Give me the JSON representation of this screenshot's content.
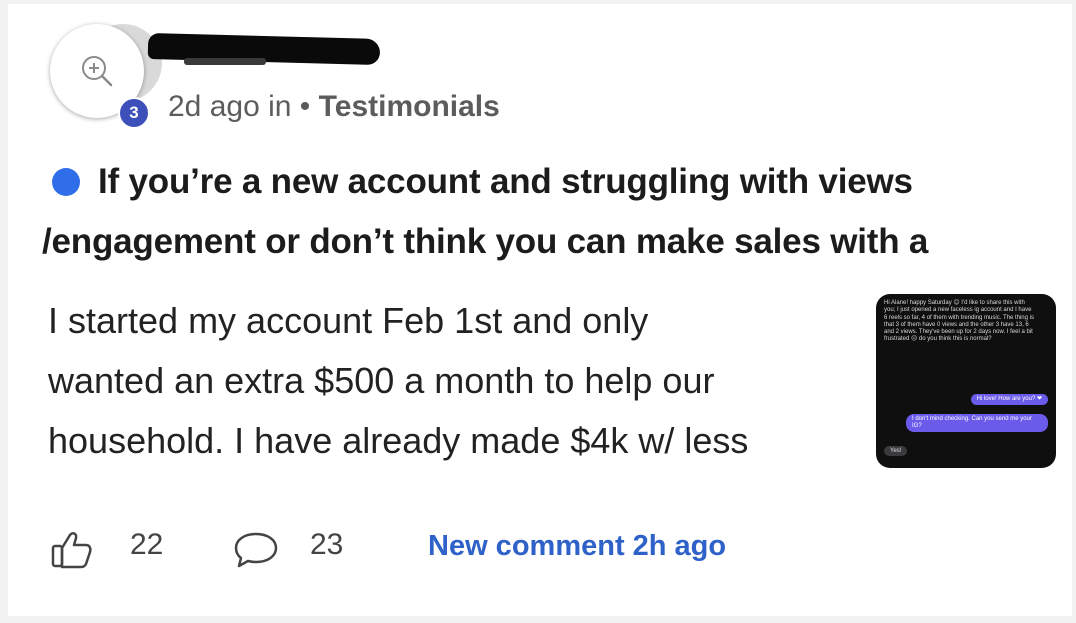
{
  "post": {
    "author_level": "3",
    "time_ago": "2d ago in",
    "separator": "•",
    "category": "Testimonials",
    "title_lines": [
      "If you’re a new account and struggling with views",
      "/engagement or don’t think you can make sales with a"
    ],
    "body_lines": [
      "I started my account Feb 1st and only",
      "wanted an extra $500 a month to help our",
      "household. I have already made $4k w/ less"
    ]
  },
  "attachment": {
    "incoming_message": "Hi Alane! happy Saturday 😊 I'd like to share this with you; I just opened a new faceless ig account and I have 6 reels so far, 4 of them with trending music. The thing is that 3 of them have 0 views and the other 3 have 13, 6 and 2 views. They've been up for 2 days now. I feel a bit frustrated 😔 do you think this is normal?",
    "reply_1": "Hi love! How are you? ❤",
    "reply_2": "I don't mind checking. Can you send me your IG?",
    "incoming_2": "Yes!"
  },
  "footer": {
    "likes": "22",
    "comments": "23",
    "new_comment": "New comment 2h ago"
  },
  "colors": {
    "accent_blue": "#2f62c9",
    "unread_dot": "#2f6ee8",
    "level_badge": "#3d4fb8"
  },
  "icons": [
    "zoom-in-icon",
    "thumbs-up-icon",
    "comment-icon"
  ]
}
